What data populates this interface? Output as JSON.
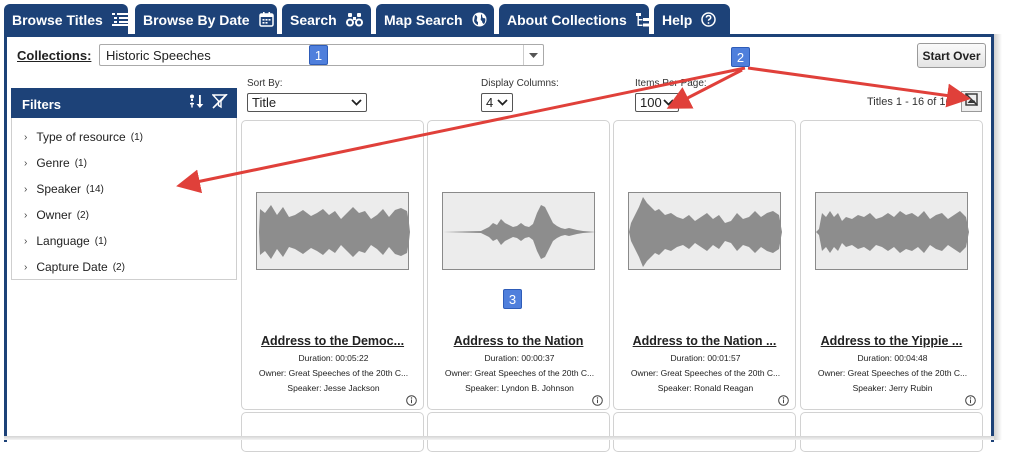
{
  "tabs": [
    {
      "label": "Browse Titles",
      "icon": "list-icon",
      "active": true
    },
    {
      "label": "Browse By Date",
      "icon": "calendar-icon"
    },
    {
      "label": "Search",
      "icon": "binoculars-icon"
    },
    {
      "label": "Map Search",
      "icon": "globe-icon"
    },
    {
      "label": "About Collections",
      "icon": "tree-icon"
    },
    {
      "label": "Help",
      "icon": "question-circle-icon"
    }
  ],
  "collections": {
    "label": "Collections:",
    "selected": "Historic Speeches",
    "start_over": "Start Over"
  },
  "callouts": [
    "1",
    "2",
    "3"
  ],
  "filters": {
    "title": "Filters",
    "items": [
      {
        "label": "Type of resource",
        "count": "(1)"
      },
      {
        "label": "Genre",
        "count": "(1)"
      },
      {
        "label": "Speaker",
        "count": "(14)"
      },
      {
        "label": "Owner",
        "count": "(2)"
      },
      {
        "label": "Language",
        "count": "(1)"
      },
      {
        "label": "Capture Date",
        "count": "(2)"
      }
    ]
  },
  "controls": {
    "sort_label": "Sort By:",
    "sort_value": "Title",
    "columns_label": "Display Columns:",
    "columns_value": "4",
    "per_page_label": "Items Per Page:",
    "per_page_value": "100",
    "titles_count": "Titles 1 - 16 of 16"
  },
  "cards": [
    {
      "title": "Address to the Democ...",
      "duration": "Duration: 00:05:22",
      "owner": "Owner: Great Speeches of the 20th C...",
      "speaker": "Speaker: Jesse Jackson"
    },
    {
      "title": "Address to the Nation",
      "duration": "Duration: 00:00:37",
      "owner": "Owner: Great Speeches of the 20th C...",
      "speaker": "Speaker: Lyndon B. Johnson"
    },
    {
      "title": "Address to the Nation ...",
      "duration": "Duration: 00:01:57",
      "owner": "Owner: Great Speeches of the 20th C...",
      "speaker": "Speaker: Ronald Reagan"
    },
    {
      "title": "Address to the Yippie ...",
      "duration": "Duration: 00:04:48",
      "owner": "Owner: Great Speeches of the 20th C...",
      "speaker": "Speaker: Jerry Rubin"
    }
  ],
  "colors": {
    "tab_bg": "#1d4278",
    "callout": "#4f7fdc",
    "arrow": "#e0403a"
  }
}
